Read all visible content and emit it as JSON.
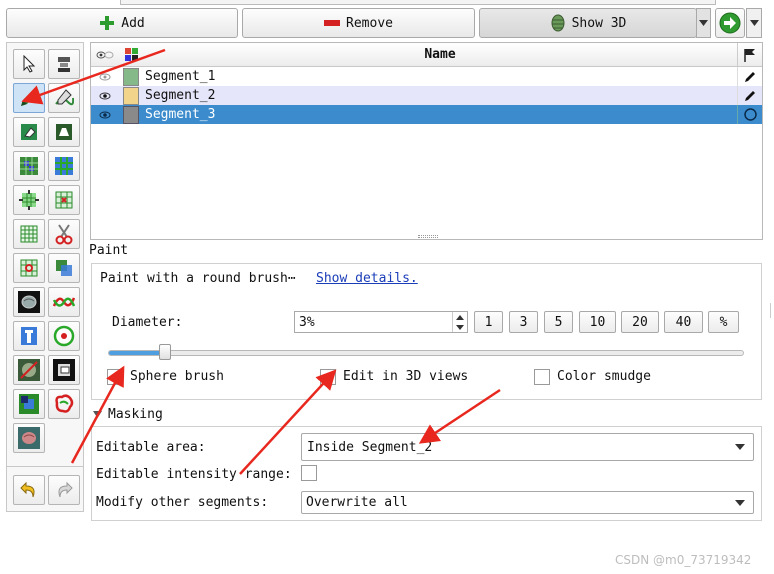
{
  "toolbar": {
    "add_label": "Add",
    "remove_label": "Remove",
    "show3d_label": "Show 3D"
  },
  "segments_table": {
    "header_name": "Name",
    "rows": [
      {
        "name": "Segment_1",
        "color": "#86b98a",
        "status": "edit"
      },
      {
        "name": "Segment_2",
        "color": "#f2d48a",
        "status": "edit"
      },
      {
        "name": "Segment_3",
        "color": "#8a8a8a",
        "status": "circle",
        "selected": true
      }
    ]
  },
  "paint": {
    "section_title": "Paint",
    "description": "Paint with a round brush⋯",
    "show_details_link": "Show details.",
    "diameter_label": "Diameter:",
    "diameter_value": "3%",
    "diameter_presets": [
      "1",
      "3",
      "5",
      "10",
      "20",
      "40",
      "%"
    ],
    "slider_fraction": 0.09,
    "sphere_brush_label": "Sphere brush",
    "sphere_brush_checked": true,
    "edit_3d_label": "Edit in 3D views",
    "edit_3d_checked": true,
    "color_smudge_label": "Color smudge",
    "color_smudge_checked": false
  },
  "masking": {
    "section_title": "Masking",
    "editable_area_label": "Editable area:",
    "editable_area_value": "Inside Segment_2",
    "intensity_label": "Editable intensity range:",
    "intensity_checked": false,
    "modify_label": "Modify other segments:",
    "modify_value": "Overwrite all"
  },
  "watermark": "CSDN @m0_73719342",
  "colors": {
    "selection": "#3c8ccd",
    "row_alt": "#e6e6fa",
    "arrow": "#e8281e",
    "link": "#1a3db8"
  }
}
